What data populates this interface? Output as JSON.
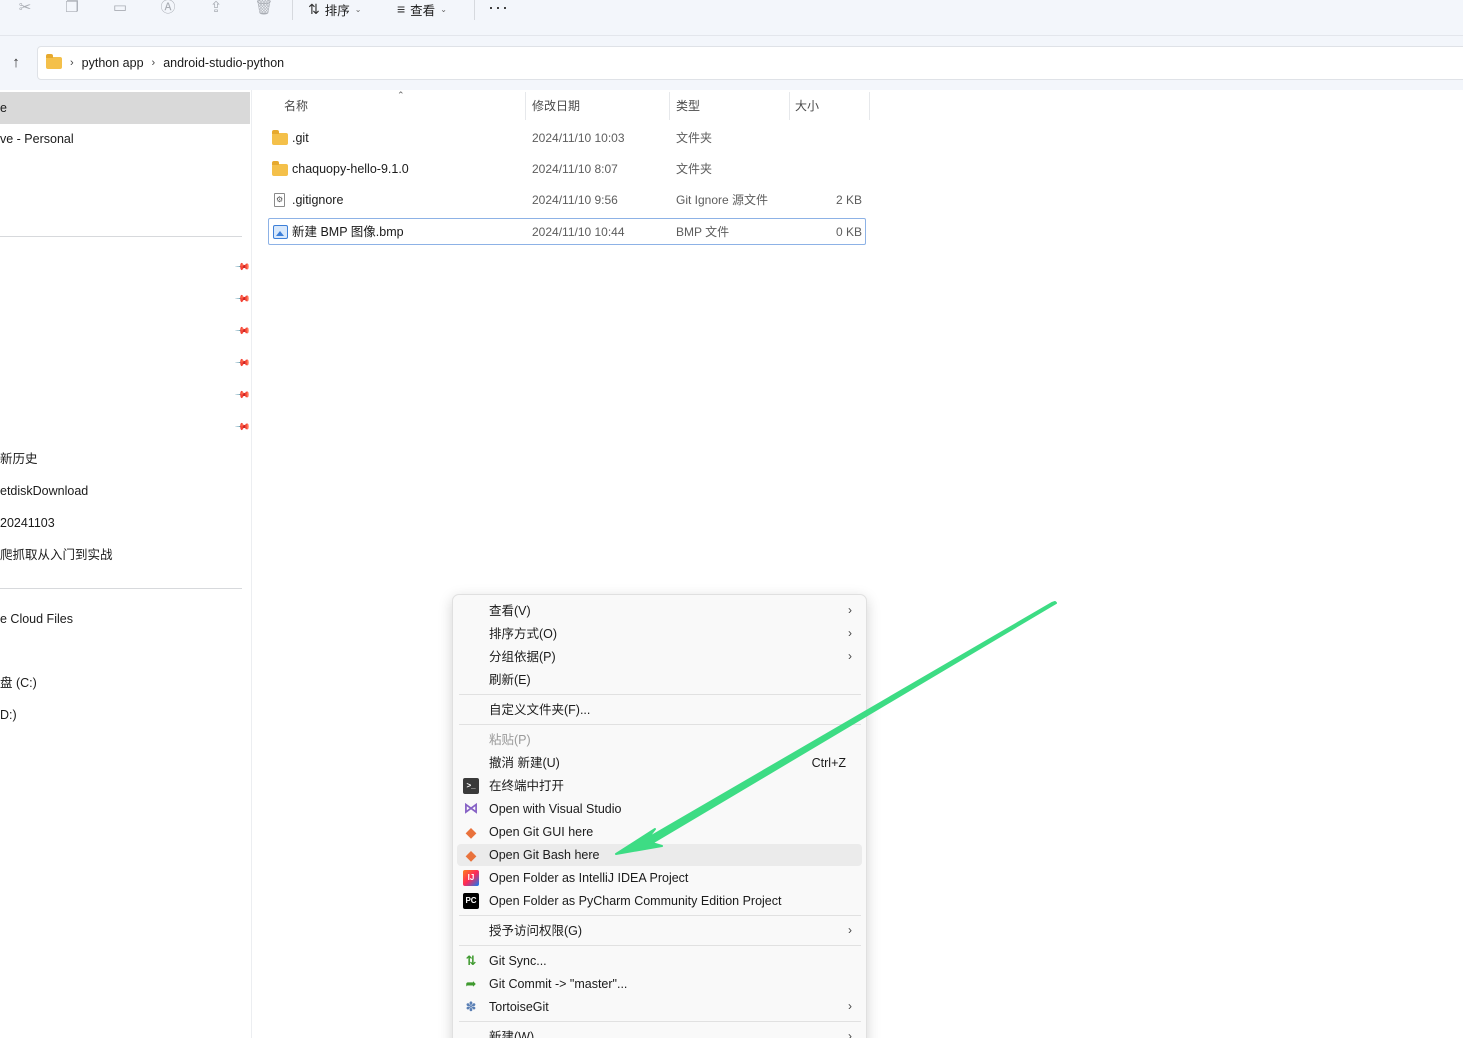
{
  "toolbar": {
    "sort_label": "排序",
    "view_label": "查看",
    "more_label": "···"
  },
  "breadcrumb": {
    "items": [
      "python app",
      "android-studio-python"
    ]
  },
  "sidebar": {
    "items": [
      {
        "label": "e"
      },
      {
        "label": "ve - Personal"
      },
      {
        "label": "新历史"
      },
      {
        "label": "etdiskDownload"
      },
      {
        "label": "20241103"
      },
      {
        "label": "爬抓取从入门到实战"
      },
      {
        "label": "e Cloud Files"
      },
      {
        "label": "盘 (C:)"
      },
      {
        "label": "D:)"
      }
    ]
  },
  "columns": {
    "name": "名称",
    "modified": "修改日期",
    "type": "类型",
    "size": "大小"
  },
  "files": [
    {
      "name": ".git",
      "modified": "2024/11/10 10:03",
      "type": "文件夹",
      "size": "",
      "icon": "folder-icon"
    },
    {
      "name": "chaquopy-hello-9.1.0",
      "modified": "2024/11/10 8:07",
      "type": "文件夹",
      "size": "",
      "icon": "folder-icon"
    },
    {
      "name": ".gitignore",
      "modified": "2024/11/10 9:56",
      "type": "Git Ignore 源文件",
      "size": "2 KB",
      "icon": "config-file-icon"
    },
    {
      "name": "新建 BMP 图像.bmp",
      "modified": "2024/11/10 10:44",
      "type": "BMP 文件",
      "size": "0 KB",
      "icon": "image-file-icon"
    }
  ],
  "context_menu": {
    "items": [
      {
        "label": "查看(V)",
        "submenu": true
      },
      {
        "label": "排序方式(O)",
        "submenu": true
      },
      {
        "label": "分组依据(P)",
        "submenu": true
      },
      {
        "label": "刷新(E)"
      },
      {
        "label": "自定义文件夹(F)..."
      },
      {
        "label": "粘贴(P)",
        "disabled": true
      },
      {
        "label": "撤消 新建(U)",
        "shortcut": "Ctrl+Z"
      },
      {
        "label": "在终端中打开",
        "icon": "terminal-icon"
      },
      {
        "label": "Open with Visual Studio",
        "icon": "visual-studio-icon"
      },
      {
        "label": "Open Git GUI here",
        "icon": "git-icon"
      },
      {
        "label": "Open Git Bash here",
        "icon": "git-icon",
        "highlighted": true
      },
      {
        "label": "Open Folder as IntelliJ IDEA Project",
        "icon": "intellij-icon"
      },
      {
        "label": "Open Folder as PyCharm Community Edition Project",
        "icon": "pycharm-icon",
        "icon_text": "PC"
      },
      {
        "label": "授予访问权限(G)",
        "submenu": true
      },
      {
        "label": "Git Sync...",
        "icon": "tortoisegit-sync-icon"
      },
      {
        "label": "Git Commit -> \"master\"...",
        "icon": "tortoisegit-commit-icon"
      },
      {
        "label": "TortoiseGit",
        "icon": "tortoisegit-icon",
        "submenu": true
      },
      {
        "label": "新建(W)",
        "submenu": true
      }
    ]
  },
  "colors": {
    "annotation_arrow": "#3ddc84",
    "selection_border": "#8db2e6",
    "folder": "#f4c04a"
  }
}
